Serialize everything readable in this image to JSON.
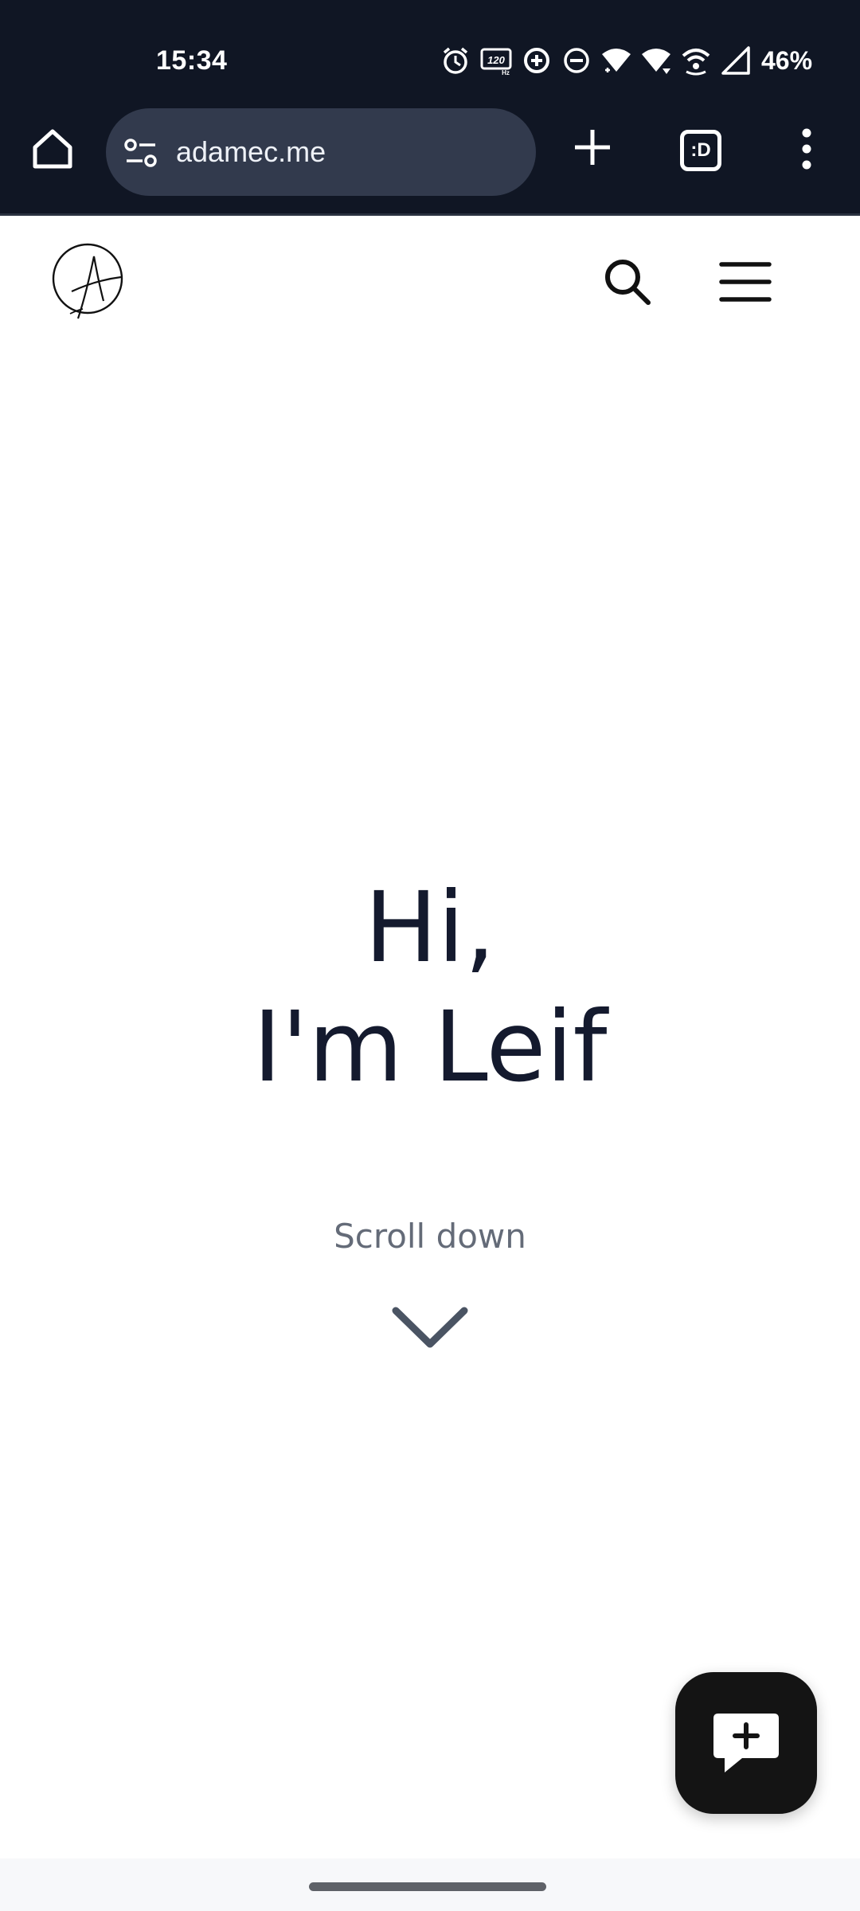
{
  "status_bar": {
    "time": "15:34",
    "battery": "46%",
    "icons": [
      "alarm-icon",
      "refresh-rate-120hz-icon",
      "data-saver-icon",
      "do-not-disturb-icon",
      "wifi-icon",
      "wifi-icon",
      "hotspot-icon",
      "cell-signal-icon"
    ]
  },
  "browser": {
    "url": "adamec.me",
    "tab_switcher_label": ":D"
  },
  "hero": {
    "line1": "Hi,",
    "line2": "I'm Leif",
    "scroll_label": "Scroll down"
  },
  "colors": {
    "status_bar_bg": "#101624",
    "url_pill_bg": "#323a4d",
    "heading_text": "#141a2e",
    "muted_text": "#646b78",
    "fab_bg": "#141414"
  }
}
